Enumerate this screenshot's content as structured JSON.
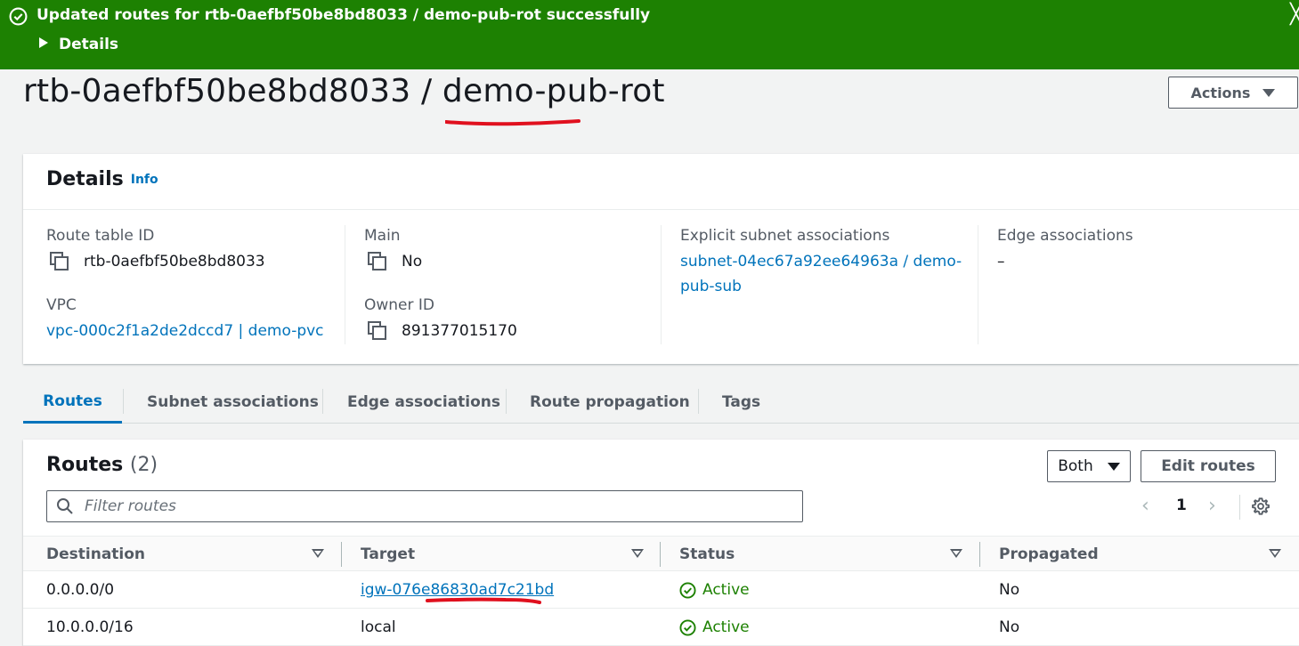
{
  "flash": {
    "message": "Updated routes for rtb-0aefbf50be8bd8033 / demo-pub-rot successfully",
    "details_label": "Details",
    "close_glyph": "╳"
  },
  "header": {
    "title": "rtb-0aefbf50be8bd8033 / demo-pub-rot",
    "actions_label": "Actions"
  },
  "details": {
    "title": "Details",
    "info_label": "Info",
    "fields": {
      "route_table_id_label": "Route table ID",
      "route_table_id_value": "rtb-0aefbf50be8bd8033",
      "vpc_label": "VPC",
      "vpc_value": "vpc-000c2f1a2de2dccd7 | demo-pvc",
      "main_label": "Main",
      "main_value": "No",
      "owner_id_label": "Owner ID",
      "owner_id_value": "891377015170",
      "explicit_subnet_label": "Explicit subnet associations",
      "explicit_subnet_line1": "subnet-04ec67a92ee64963a / demo-",
      "explicit_subnet_line2": "pub-sub",
      "edge_label": "Edge associations",
      "edge_value": "–"
    }
  },
  "tabs": [
    {
      "label": "Routes",
      "active": true
    },
    {
      "label": "Subnet associations",
      "active": false
    },
    {
      "label": "Edge associations",
      "active": false
    },
    {
      "label": "Route propagation",
      "active": false
    },
    {
      "label": "Tags",
      "active": false
    }
  ],
  "routes": {
    "title": "Routes",
    "count": "(2)",
    "filter_select": "Both",
    "edit_label": "Edit routes",
    "search_placeholder": "Filter routes",
    "page": "1",
    "columns": [
      "Destination",
      "Target",
      "Status",
      "Propagated"
    ],
    "rows": [
      {
        "destination": "0.0.0.0/0",
        "target": "igw-076e86830ad7c21bd",
        "status": "Active",
        "propagated": "No"
      },
      {
        "destination": "10.0.0.0/16",
        "target": "local",
        "status": "Active",
        "propagated": "No"
      }
    ]
  },
  "colors": {
    "success_green": "#1d8102",
    "link_blue": "#0073bb",
    "annotation_red": "#e0101e"
  }
}
